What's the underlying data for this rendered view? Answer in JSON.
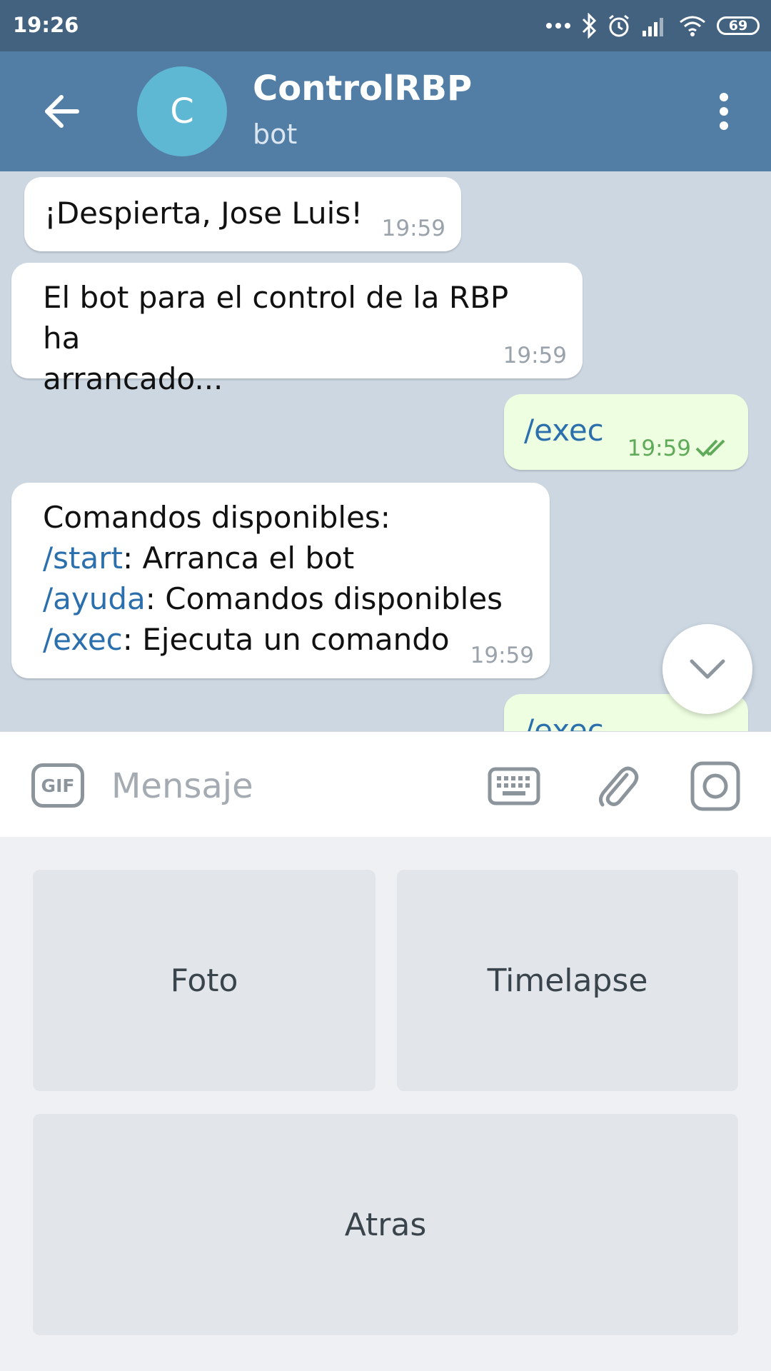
{
  "status_bar": {
    "time": "19:26",
    "battery": "69"
  },
  "header": {
    "avatar_letter": "C",
    "title": "ControlRBP",
    "subtitle": "bot"
  },
  "messages": [
    {
      "text": "¡Despierta, Jose Luis!",
      "time": "19:59"
    },
    {
      "line1": "El bot para el control de la RBP ha",
      "line2": "arrancado...",
      "time": "19:59"
    },
    {
      "text": "/exec",
      "time": "19:59"
    },
    {
      "line1": "Comandos disponibles:",
      "cmd1": "/start",
      "desc1": ": Arranca el bot",
      "cmd2": "/ayuda",
      "desc2": ": Comandos disponibles",
      "cmd3": "/exec",
      "desc3": ": Ejecuta un comando",
      "time": "19:59"
    },
    {
      "text": "/exec"
    }
  ],
  "input": {
    "gif_label": "GIF",
    "placeholder": "Mensaje"
  },
  "keyboard": {
    "buttons": [
      "Foto",
      "Timelapse",
      "Atras"
    ]
  }
}
